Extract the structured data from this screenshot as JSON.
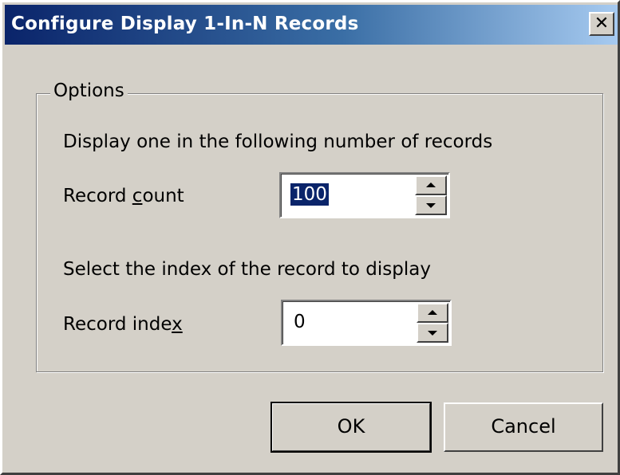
{
  "window": {
    "title": "Configure Display 1-In-N Records",
    "close_glyph": "✕"
  },
  "options": {
    "legend": "Options",
    "count_description": "Display one in the following number of records",
    "count_label_before": "Record ",
    "count_label_underlined": "c",
    "count_label_after": "ount",
    "count_value": "100",
    "index_description": "Select the index of the record to display",
    "index_label_before": "Record inde",
    "index_label_underlined": "x",
    "index_label_after": "",
    "index_value": "0"
  },
  "buttons": {
    "ok_label": "OK",
    "cancel_label": "Cancel"
  },
  "colors": {
    "titlebar_start": "#0a246a",
    "titlebar_end": "#a6caf0",
    "face": "#d4d0c8",
    "selection": "#0a246a"
  },
  "icons": [
    "close-icon",
    "spin-up-icon",
    "spin-down-icon"
  ]
}
